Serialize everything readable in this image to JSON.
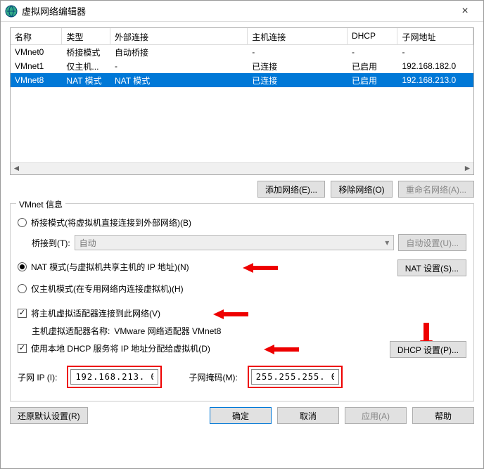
{
  "window": {
    "title": "虚拟网络编辑器",
    "close": "×"
  },
  "table": {
    "headers": [
      "名称",
      "类型",
      "外部连接",
      "主机连接",
      "DHCP",
      "子网地址"
    ],
    "rows": [
      {
        "c": [
          "VMnet0",
          "桥接模式",
          "自动桥接",
          "-",
          "-",
          "-"
        ],
        "sel": false
      },
      {
        "c": [
          "VMnet1",
          "仅主机...",
          "-",
          "已连接",
          "已启用",
          "192.168.182.0"
        ],
        "sel": false
      },
      {
        "c": [
          "VMnet8",
          "NAT 模式",
          "NAT 模式",
          "已连接",
          "已启用",
          "192.168.213.0"
        ],
        "sel": true
      }
    ]
  },
  "buttons": {
    "add": "添加网络(E)...",
    "remove": "移除网络(O)",
    "rename": "重命名网络(A)...",
    "autoset": "自动设置(U)...",
    "natset": "NAT 设置(S)...",
    "dhcpset": "DHCP 设置(P)...",
    "restore": "还原默认设置(R)",
    "ok": "确定",
    "cancel": "取消",
    "apply": "应用(A)",
    "help": "帮助"
  },
  "group": {
    "legend": "VMnet 信息",
    "bridged": "桥接模式(将虚拟机直接连接到外部网络)(B)",
    "bridgeto": "桥接到(T):",
    "bridgeto_val": "自动",
    "nat": "NAT 模式(与虚拟机共享主机的 IP 地址)(N)",
    "hostonly": "仅主机模式(在专用网络内连接虚拟机)(H)",
    "connect": "将主机虚拟适配器连接到此网络(V)",
    "adapter_label": "主机虚拟适配器名称: ",
    "adapter_val": "VMware 网络适配器 VMnet8",
    "dhcp": "使用本地 DHCP 服务将 IP 地址分配给虚拟机(D)",
    "subnet_ip_label": "子网 IP (I):",
    "subnet_ip": "192.168.213. 0",
    "subnet_mask_label": "子网掩码(M):",
    "subnet_mask": "255.255.255. 0"
  }
}
